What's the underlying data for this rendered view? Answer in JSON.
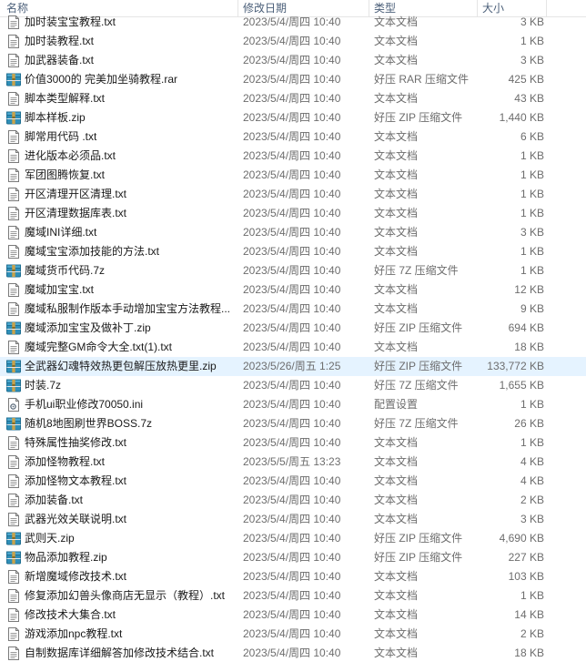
{
  "columns": {
    "name": "名称",
    "date": "修改日期",
    "type": "类型",
    "size": "大小"
  },
  "files": [
    {
      "name": "加时装宝宝教程.txt",
      "date": "2023/5/4/周四 10:40",
      "type": "文本文档",
      "size": "3 KB",
      "icon": "text-file-icon"
    },
    {
      "name": "加时装教程.txt",
      "date": "2023/5/4/周四 10:40",
      "type": "文本文档",
      "size": "1 KB",
      "icon": "text-file-icon"
    },
    {
      "name": "加武器装备.txt",
      "date": "2023/5/4/周四 10:40",
      "type": "文本文档",
      "size": "3 KB",
      "icon": "text-file-icon"
    },
    {
      "name": "价值3000的 完美加坐骑教程.rar",
      "date": "2023/5/4/周四 10:40",
      "type": "好压 RAR 压缩文件",
      "size": "425 KB",
      "icon": "archive-icon"
    },
    {
      "name": "脚本类型解释.txt",
      "date": "2023/5/4/周四 10:40",
      "type": "文本文档",
      "size": "43 KB",
      "icon": "text-file-icon"
    },
    {
      "name": "脚本样板.zip",
      "date": "2023/5/4/周四 10:40",
      "type": "好压 ZIP 压缩文件",
      "size": "1,440 KB",
      "icon": "archive-icon"
    },
    {
      "name": "脚常用代码 .txt",
      "date": "2023/5/4/周四 10:40",
      "type": "文本文档",
      "size": "6 KB",
      "icon": "text-file-icon"
    },
    {
      "name": "进化版本必须品.txt",
      "date": "2023/5/4/周四 10:40",
      "type": "文本文档",
      "size": "1 KB",
      "icon": "text-file-icon"
    },
    {
      "name": "军团图腾恢复.txt",
      "date": "2023/5/4/周四 10:40",
      "type": "文本文档",
      "size": "1 KB",
      "icon": "text-file-icon"
    },
    {
      "name": "开区清理开区清理.txt",
      "date": "2023/5/4/周四 10:40",
      "type": "文本文档",
      "size": "1 KB",
      "icon": "text-file-icon"
    },
    {
      "name": "开区清理数据库表.txt",
      "date": "2023/5/4/周四 10:40",
      "type": "文本文档",
      "size": "1 KB",
      "icon": "text-file-icon"
    },
    {
      "name": "魔域INI详细.txt",
      "date": "2023/5/4/周四 10:40",
      "type": "文本文档",
      "size": "3 KB",
      "icon": "text-file-icon"
    },
    {
      "name": "魔域宝宝添加技能的方法.txt",
      "date": "2023/5/4/周四 10:40",
      "type": "文本文档",
      "size": "1 KB",
      "icon": "text-file-icon"
    },
    {
      "name": "魔域货币代码.7z",
      "date": "2023/5/4/周四 10:40",
      "type": "好压 7Z 压缩文件",
      "size": "1 KB",
      "icon": "archive-icon"
    },
    {
      "name": "魔域加宝宝.txt",
      "date": "2023/5/4/周四 10:40",
      "type": "文本文档",
      "size": "12 KB",
      "icon": "text-file-icon"
    },
    {
      "name": "魔域私服制作版本手动增加宝宝方法教程...",
      "date": "2023/5/4/周四 10:40",
      "type": "文本文档",
      "size": "9 KB",
      "icon": "text-file-icon"
    },
    {
      "name": "魔域添加宝宝及做补丁.zip",
      "date": "2023/5/4/周四 10:40",
      "type": "好压 ZIP 压缩文件",
      "size": "694 KB",
      "icon": "archive-icon"
    },
    {
      "name": "魔域完整GM命令大全.txt(1).txt",
      "date": "2023/5/4/周四 10:40",
      "type": "文本文档",
      "size": "18 KB",
      "icon": "text-file-icon"
    },
    {
      "name": "全武器幻魂特效热更包解压放热更里.zip",
      "date": "2023/5/26/周五 1:25",
      "type": "好压 ZIP 压缩文件",
      "size": "133,772 KB",
      "icon": "archive-icon",
      "selected": true
    },
    {
      "name": "时装.7z",
      "date": "2023/5/4/周四 10:40",
      "type": "好压 7Z 压缩文件",
      "size": "1,655 KB",
      "icon": "archive-icon"
    },
    {
      "name": "手机ui职业修改70050.ini",
      "date": "2023/5/4/周四 10:40",
      "type": "配置设置",
      "size": "1 KB",
      "icon": "settings-file-icon"
    },
    {
      "name": "随机8地图刷世界BOSS.7z",
      "date": "2023/5/4/周四 10:40",
      "type": "好压 7Z 压缩文件",
      "size": "26 KB",
      "icon": "archive-icon"
    },
    {
      "name": "特殊属性抽奖修改.txt",
      "date": "2023/5/4/周四 10:40",
      "type": "文本文档",
      "size": "1 KB",
      "icon": "text-file-icon"
    },
    {
      "name": "添加怪物教程.txt",
      "date": "2023/5/5/周五 13:23",
      "type": "文本文档",
      "size": "4 KB",
      "icon": "text-file-icon"
    },
    {
      "name": "添加怪物文本教程.txt",
      "date": "2023/5/4/周四 10:40",
      "type": "文本文档",
      "size": "4 KB",
      "icon": "text-file-icon"
    },
    {
      "name": "添加装备.txt",
      "date": "2023/5/4/周四 10:40",
      "type": "文本文档",
      "size": "2 KB",
      "icon": "text-file-icon"
    },
    {
      "name": "武器光效关联说明.txt",
      "date": "2023/5/4/周四 10:40",
      "type": "文本文档",
      "size": "3 KB",
      "icon": "text-file-icon"
    },
    {
      "name": "武则天.zip",
      "date": "2023/5/4/周四 10:40",
      "type": "好压 ZIP 压缩文件",
      "size": "4,690 KB",
      "icon": "archive-icon"
    },
    {
      "name": "物品添加教程.zip",
      "date": "2023/5/4/周四 10:40",
      "type": "好压 ZIP 压缩文件",
      "size": "227 KB",
      "icon": "archive-icon"
    },
    {
      "name": "新增魔域修改技术.txt",
      "date": "2023/5/4/周四 10:40",
      "type": "文本文档",
      "size": "103 KB",
      "icon": "text-file-icon"
    },
    {
      "name": "修复添加幻兽头像商店无显示（教程）.txt",
      "date": "2023/5/4/周四 10:40",
      "type": "文本文档",
      "size": "1 KB",
      "icon": "text-file-icon"
    },
    {
      "name": "修改技术大集合.txt",
      "date": "2023/5/4/周四 10:40",
      "type": "文本文档",
      "size": "14 KB",
      "icon": "text-file-icon"
    },
    {
      "name": "游戏添加npc教程.txt",
      "date": "2023/5/4/周四 10:40",
      "type": "文本文档",
      "size": "2 KB",
      "icon": "text-file-icon"
    },
    {
      "name": "自制数据库详细解答加修改技术结合.txt",
      "date": "2023/5/4/周四 10:40",
      "type": "文本文档",
      "size": "18 KB",
      "icon": "text-file-icon"
    }
  ],
  "colors": {
    "selected_row": "#e5f3ff",
    "header_text": "#4c607a",
    "secondary_text": "#6d6d6d",
    "archive_teal": "#2f8fb8",
    "archive_band": "#c9a24a"
  }
}
